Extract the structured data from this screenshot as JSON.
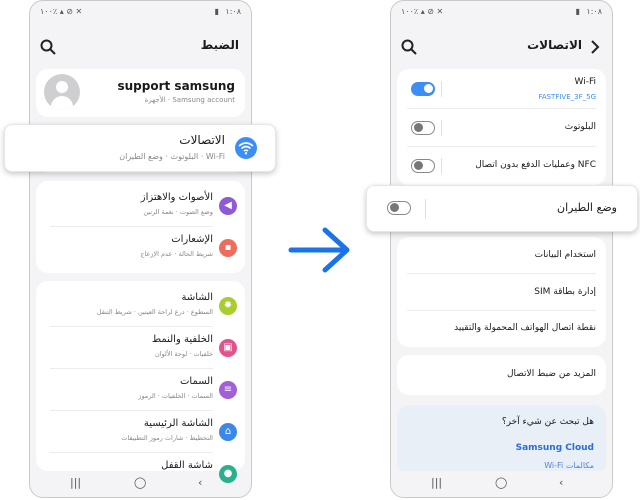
{
  "left_phone": {
    "status": {
      "time": "١:٠٨",
      "battery": "١٠٠٪"
    },
    "header": {
      "title": "الضبط"
    },
    "profile": {
      "name": "support samsung",
      "subtitle": "Samsung account · الأجهزة"
    },
    "connections": {
      "title": "الاتصالات",
      "subtitle": "Wi-Fi · البلوتوث · وضع الطيران",
      "icon": "wifi-icon",
      "color": "#3d8ef4"
    },
    "group2": [
      {
        "name": "sounds",
        "title": "الأصوات والاهتزاز",
        "subtitle": "وضع الصوت · نغمة الرنين",
        "icon": "speaker-icon",
        "color": "#8e5ad6"
      },
      {
        "name": "notifications",
        "title": "الإشعارات",
        "subtitle": "شريط الحالة · عدم الإزعاج",
        "icon": "bell-icon",
        "color": "#ef6c5c"
      }
    ],
    "group3": [
      {
        "name": "display",
        "title": "الشاشة",
        "subtitle": "السطوع · درع لراحة العينين · شريط التنقل",
        "icon": "sun-icon",
        "color": "#a9cd2e"
      },
      {
        "name": "wallpaper",
        "title": "الخلفية والنمط",
        "subtitle": "خلفيات · لوحة الألوان",
        "icon": "picture-icon",
        "color": "#e2528c"
      },
      {
        "name": "themes",
        "title": "السمات",
        "subtitle": "السمات · الخلفيات · الرموز",
        "icon": "brush-icon",
        "color": "#a35fd7"
      },
      {
        "name": "home-screen",
        "title": "الشاشة الرئيسية",
        "subtitle": "التخطيط · شارات رموز التطبيقات",
        "icon": "home-icon",
        "color": "#3b88e6"
      },
      {
        "name": "lock-screen",
        "title": "شاشة القفل",
        "subtitle": "",
        "icon": "lock-icon",
        "color": "#2bb08e"
      }
    ],
    "navbar": {
      "recent": "|||",
      "home": "◯",
      "back": "‹"
    }
  },
  "right_phone": {
    "status": {
      "time": "١:٠٨",
      "battery": "١٠٠٪"
    },
    "header": {
      "title": "الاتصالات"
    },
    "rows": [
      {
        "name": "wifi",
        "title": "Wi-Fi",
        "subtitle": "FASTFIVE_3F_5G",
        "toggle": "on"
      },
      {
        "name": "bluetooth",
        "title": "البلوتوث",
        "toggle": "off"
      },
      {
        "name": "nfc",
        "title": "NFC وعمليات الدفع بدون اتصال",
        "toggle": "off"
      }
    ],
    "airplane": {
      "title": "وضع الطيران",
      "toggle": "off"
    },
    "rows2": [
      {
        "name": "data-usage",
        "title": "استخدام البيانات"
      },
      {
        "name": "sim-manager",
        "title": "إدارة بطاقة SIM"
      },
      {
        "name": "hotspot",
        "title": "نقطة اتصال الهواتف المحمولة والتقييد"
      }
    ],
    "more": {
      "title": "المزيد من ضبط الاتصال"
    },
    "suggest": {
      "question": "هل تبحث عن شيء آخر؟",
      "link": "Samsung Cloud",
      "link2": "مكالمات Wi-Fi"
    },
    "navbar": {
      "recent": "|||",
      "home": "◯",
      "back": "‹"
    }
  },
  "arrow_color": "#1a73e8"
}
